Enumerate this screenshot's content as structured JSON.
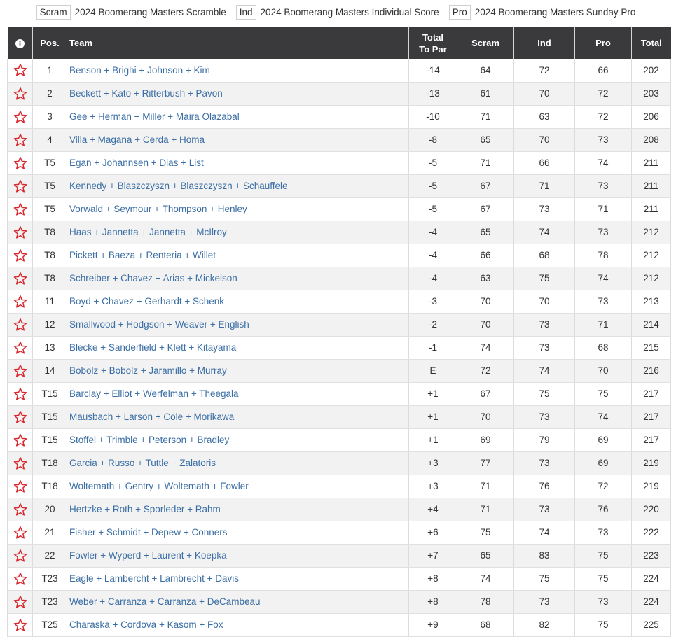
{
  "legend": [
    {
      "code": "Scram",
      "label": "2024 Boomerang Masters Scramble"
    },
    {
      "code": "Ind",
      "label": "2024 Boomerang Masters Individual Score"
    },
    {
      "code": "Pro",
      "label": "2024 Boomerang Masters Sunday Pro"
    }
  ],
  "header": {
    "pos": "Pos.",
    "team": "Team",
    "topar_line1": "Total",
    "topar_line2": "To Par",
    "scram": "Scram",
    "ind": "Ind",
    "pro": "Pro",
    "total": "Total"
  },
  "colors": {
    "header_bg": "#3a3a3d",
    "star": "#d9272e",
    "link": "#3a6ea5",
    "stripe": "#f2f2f2"
  },
  "icons": {
    "info": "info-icon",
    "favorite": "star-outline-icon"
  },
  "rows": [
    {
      "pos": "1",
      "team": "Benson + Brighi + Johnson + Kim",
      "topar": "-14",
      "scram": "64",
      "ind": "72",
      "pro": "66",
      "total": "202"
    },
    {
      "pos": "2",
      "team": "Beckett + Kato + Ritterbush + Pavon",
      "topar": "-13",
      "scram": "61",
      "ind": "70",
      "pro": "72",
      "total": "203"
    },
    {
      "pos": "3",
      "team": "Gee + Herman + Miller + Maira Olazabal",
      "topar": "-10",
      "scram": "71",
      "ind": "63",
      "pro": "72",
      "total": "206"
    },
    {
      "pos": "4",
      "team": "Villa + Magana + Cerda + Homa",
      "topar": "-8",
      "scram": "65",
      "ind": "70",
      "pro": "73",
      "total": "208"
    },
    {
      "pos": "T5",
      "team": "Egan + Johannsen + Dias + List",
      "topar": "-5",
      "scram": "71",
      "ind": "66",
      "pro": "74",
      "total": "211"
    },
    {
      "pos": "T5",
      "team": "Kennedy + Blaszczyszn + Blaszczyszn + Schauffele",
      "topar": "-5",
      "scram": "67",
      "ind": "71",
      "pro": "73",
      "total": "211"
    },
    {
      "pos": "T5",
      "team": "Vorwald + Seymour + Thompson + Henley",
      "topar": "-5",
      "scram": "67",
      "ind": "73",
      "pro": "71",
      "total": "211"
    },
    {
      "pos": "T8",
      "team": "Haas + Jannetta + Jannetta + McIlroy",
      "topar": "-4",
      "scram": "65",
      "ind": "74",
      "pro": "73",
      "total": "212"
    },
    {
      "pos": "T8",
      "team": "Pickett + Baeza + Renteria + Willet",
      "topar": "-4",
      "scram": "66",
      "ind": "68",
      "pro": "78",
      "total": "212"
    },
    {
      "pos": "T8",
      "team": "Schreiber + Chavez + Arias + Mickelson",
      "topar": "-4",
      "scram": "63",
      "ind": "75",
      "pro": "74",
      "total": "212"
    },
    {
      "pos": "11",
      "team": "Boyd + Chavez + Gerhardt + Schenk",
      "topar": "-3",
      "scram": "70",
      "ind": "70",
      "pro": "73",
      "total": "213"
    },
    {
      "pos": "12",
      "team": "Smallwood + Hodgson + Weaver + English",
      "topar": "-2",
      "scram": "70",
      "ind": "73",
      "pro": "71",
      "total": "214"
    },
    {
      "pos": "13",
      "team": "Blecke + Sanderfield + Klett + Kitayama",
      "topar": "-1",
      "scram": "74",
      "ind": "73",
      "pro": "68",
      "total": "215"
    },
    {
      "pos": "14",
      "team": "Bobolz + Bobolz + Jaramillo + Murray",
      "topar": "E",
      "scram": "72",
      "ind": "74",
      "pro": "70",
      "total": "216"
    },
    {
      "pos": "T15",
      "team": "Barclay + Elliot + Werfelman + Theegala",
      "topar": "+1",
      "scram": "67",
      "ind": "75",
      "pro": "75",
      "total": "217"
    },
    {
      "pos": "T15",
      "team": "Mausbach + Larson + Cole + Morikawa",
      "topar": "+1",
      "scram": "70",
      "ind": "73",
      "pro": "74",
      "total": "217"
    },
    {
      "pos": "T15",
      "team": "Stoffel + Trimble + Peterson + Bradley",
      "topar": "+1",
      "scram": "69",
      "ind": "79",
      "pro": "69",
      "total": "217"
    },
    {
      "pos": "T18",
      "team": "Garcia + Russo + Tuttle + Zalatoris",
      "topar": "+3",
      "scram": "77",
      "ind": "73",
      "pro": "69",
      "total": "219"
    },
    {
      "pos": "T18",
      "team": "Woltemath + Gentry + Woltemath + Fowler",
      "topar": "+3",
      "scram": "71",
      "ind": "76",
      "pro": "72",
      "total": "219"
    },
    {
      "pos": "20",
      "team": "Hertzke + Roth + Sporleder + Rahm",
      "topar": "+4",
      "scram": "71",
      "ind": "73",
      "pro": "76",
      "total": "220"
    },
    {
      "pos": "21",
      "team": "Fisher + Schmidt + Depew + Conners",
      "topar": "+6",
      "scram": "75",
      "ind": "74",
      "pro": "73",
      "total": "222"
    },
    {
      "pos": "22",
      "team": "Fowler + Wyperd + Laurent + Koepka",
      "topar": "+7",
      "scram": "65",
      "ind": "83",
      "pro": "75",
      "total": "223"
    },
    {
      "pos": "T23",
      "team": "Eagle + Lambercht + Lambrecht + Davis",
      "topar": "+8",
      "scram": "74",
      "ind": "75",
      "pro": "75",
      "total": "224"
    },
    {
      "pos": "T23",
      "team": "Weber + Carranza + Carranza + DeCambeau",
      "topar": "+8",
      "scram": "78",
      "ind": "73",
      "pro": "73",
      "total": "224"
    },
    {
      "pos": "T25",
      "team": "Charaska + Cordova + Kasom + Fox",
      "topar": "+9",
      "scram": "68",
      "ind": "82",
      "pro": "75",
      "total": "225"
    }
  ]
}
